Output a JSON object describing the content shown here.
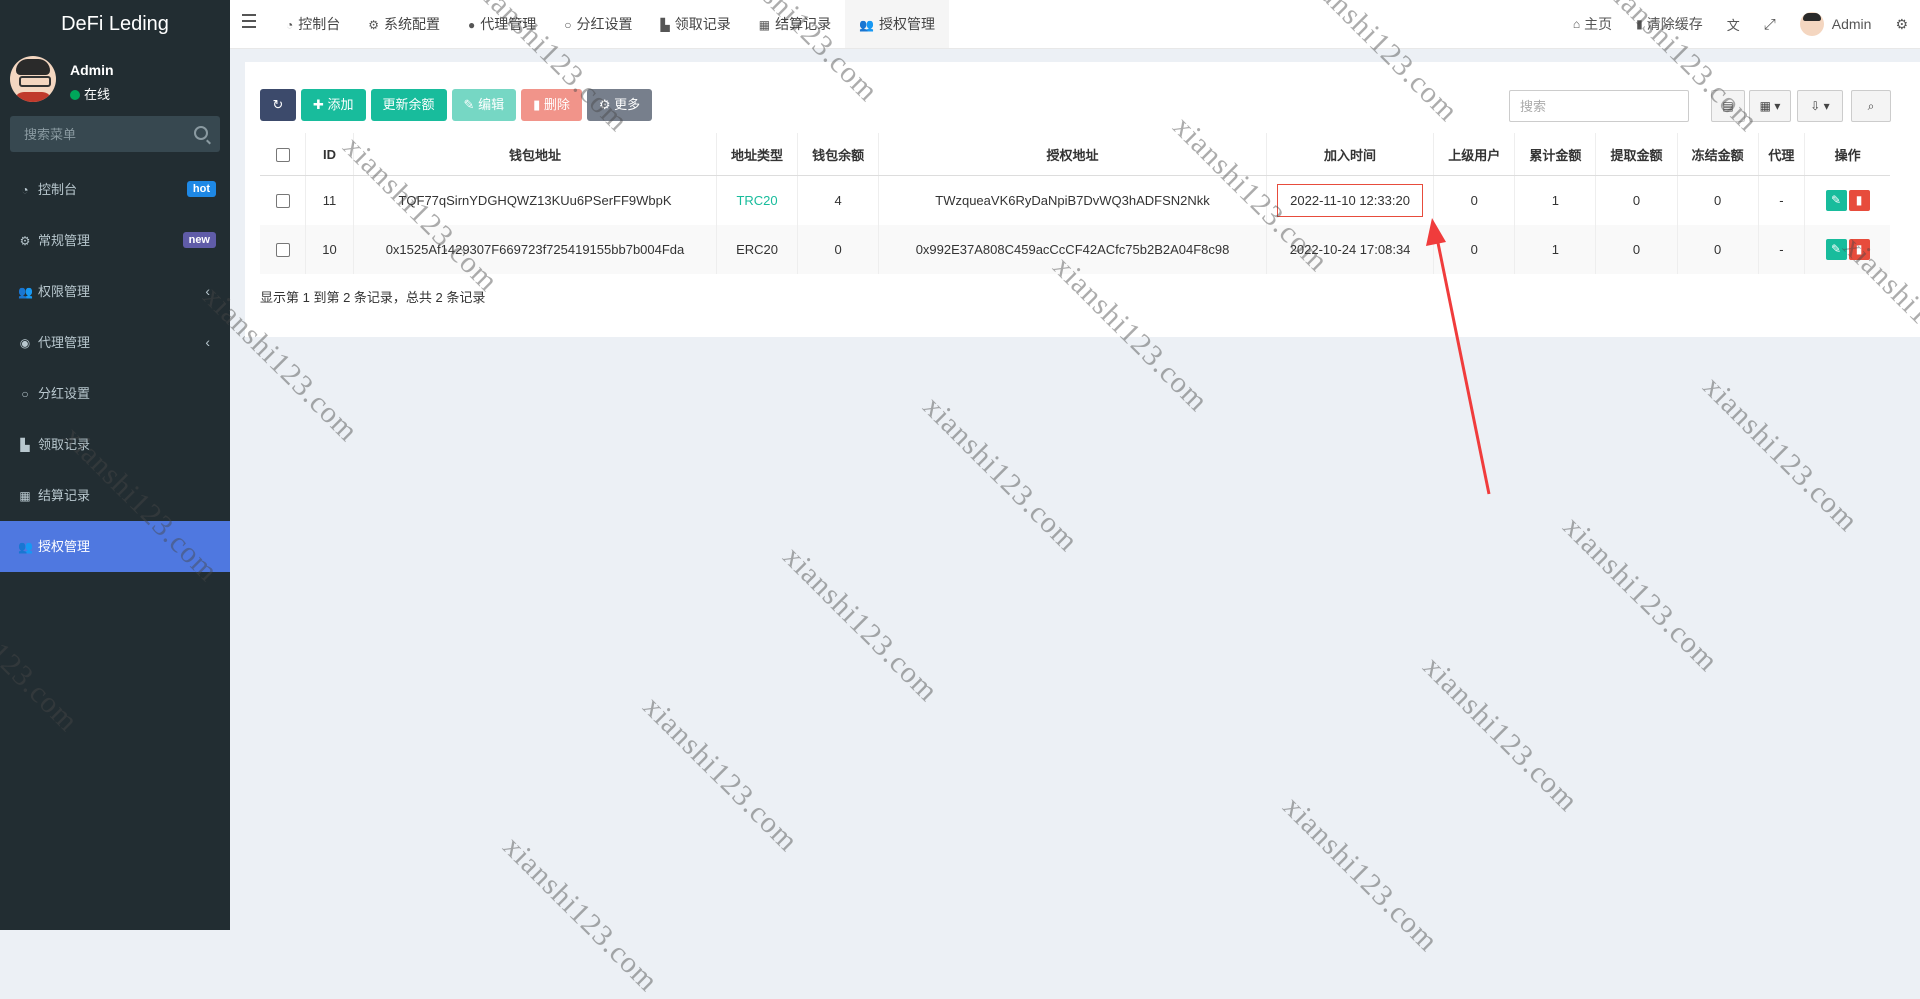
{
  "app": {
    "brand": "DeFi Leding"
  },
  "user": {
    "name": "Admin",
    "status": "在线",
    "status_color": "#00a65a"
  },
  "sidebar": {
    "search_placeholder": "搜索菜单",
    "items": [
      {
        "label": "控制台",
        "icon": "dashboard-icon",
        "badge": "hot",
        "badge_color": "#1e88e5"
      },
      {
        "label": "常规管理",
        "icon": "cogs-icon",
        "badge": "new",
        "badge_color": "#605ca8"
      },
      {
        "label": "权限管理",
        "icon": "group-icon",
        "chevron": "‹"
      },
      {
        "label": "代理管理",
        "icon": "user-circle-icon",
        "chevron": "‹"
      },
      {
        "label": "分红设置",
        "icon": "circle-icon"
      },
      {
        "label": "领取记录",
        "icon": "industry-icon"
      },
      {
        "label": "结算记录",
        "icon": "calculator-icon"
      },
      {
        "label": "授权管理",
        "icon": "group-icon",
        "active": true
      }
    ]
  },
  "topbar": {
    "tabs": [
      {
        "label": "控制台",
        "icon": "dashboard-icon"
      },
      {
        "label": "系统配置",
        "icon": "gear-icon"
      },
      {
        "label": "代理管理",
        "icon": "user-icon"
      },
      {
        "label": "分红设置",
        "icon": "circle-icon"
      },
      {
        "label": "领取记录",
        "icon": "industry-icon"
      },
      {
        "label": "结算记录",
        "icon": "calculator-icon"
      },
      {
        "label": "授权管理",
        "icon": "group-icon",
        "active": true
      }
    ],
    "home": "主页",
    "clear_cache": "清除缓存",
    "user": "Admin"
  },
  "toolbar": {
    "add": "添加",
    "update_balance": "更新余额",
    "edit": "编辑",
    "delete": "删除",
    "more": "更多",
    "search_placeholder": "搜索"
  },
  "table": {
    "headers": [
      "ID",
      "钱包地址",
      "地址类型",
      "钱包余额",
      "授权地址",
      "加入时间",
      "上级用户",
      "累计金额",
      "提取金额",
      "冻结金额",
      "代理",
      "操作"
    ],
    "rows": [
      {
        "id": "11",
        "wallet": "TQF77qSirnYDGHQWZ13KUu6PSerFF9WbpK",
        "type": "TRC20",
        "balance": "4",
        "auth": "TWzqueaVK6RyDaNpiB7DvWQ3hADFSN2Nkk",
        "time": "2022-11-10 12:33:20",
        "parent": "0",
        "total": "1",
        "withdraw": "0",
        "frozen": "0",
        "agent": "-"
      },
      {
        "id": "10",
        "wallet": "0x1525Af1429307F669723f725419155bb7b004Fda",
        "type": "ERC20",
        "balance": "0",
        "auth": "0x992E37A808C459acCcCF42ACfc75b2B2A04F8c98",
        "time": "2022-10-24 17:08:34",
        "parent": "0",
        "total": "1",
        "withdraw": "0",
        "frozen": "0",
        "agent": "-"
      }
    ],
    "summary": "显示第 1 到第 2 条记录，总共 2 条记录"
  },
  "watermark": "xianshi123.com",
  "colors": {
    "accent": "#18bc9c",
    "danger": "#e74c3c",
    "sidebar_bg": "#222d32",
    "active_menu": "#4f78e0"
  }
}
